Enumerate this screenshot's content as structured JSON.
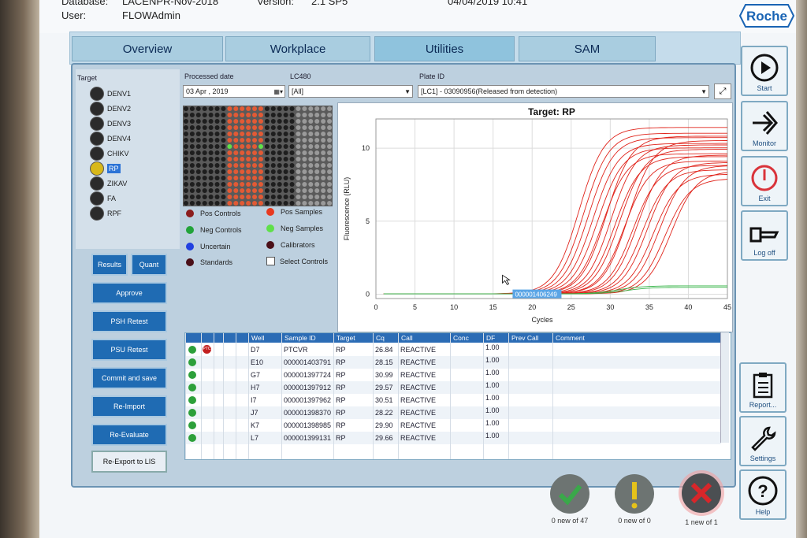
{
  "header": {
    "database_label": "Database:",
    "database_value": "LACENPR-Nov-2018",
    "user_label": "User:",
    "user_value": "FLOWAdmin",
    "version_label": "Version:",
    "version_value": "2.1 SP5",
    "datetime": "04/04/2019 10:41",
    "brand": "Roche"
  },
  "nav": {
    "tabs": [
      "Overview",
      "Workplace",
      "Utilities",
      "SAM"
    ]
  },
  "right_sidebar": {
    "start": "Start",
    "monitor": "Monitor",
    "exit": "Exit",
    "logoff": "Log off",
    "report": "Report...",
    "settings": "Settings",
    "help": "Help"
  },
  "target": {
    "label": "Target",
    "items": [
      "DENV1",
      "DENV2",
      "DENV3",
      "DENV4",
      "CHIKV",
      "RP",
      "ZIKAV",
      "FA",
      "RPF"
    ],
    "selected_index": 5
  },
  "filters": {
    "processed_date_label": "Processed date",
    "processed_date_value": "03 Apr , 2019",
    "lc480_label": "LC480",
    "lc480_value": "[All]",
    "plate_id_label": "Plate ID",
    "plate_id_value": "[LC1] - 03090956(Released from detection)"
  },
  "legend": {
    "pos_controls": "Pos Controls",
    "pos_samples": "Pos Samples",
    "neg_controls": "Neg Controls",
    "neg_samples": "Neg Samples",
    "uncertain": "Uncertain",
    "calibrators": "Calibrators",
    "standards": "Standards",
    "select_controls": "Select Controls"
  },
  "buttons": {
    "results": "Results",
    "quant": "Quant",
    "approve": "Approve",
    "psh_retest": "PSH Retest",
    "psu_retest": "PSU Retest",
    "commit_save": "Commit and save",
    "reimport": "Re-Import",
    "reevaluate": "Re-Evaluate",
    "reexport": "Re-Export to LIS"
  },
  "chart_data": {
    "type": "line",
    "title": "Target: RP",
    "xlabel": "Cycles",
    "ylabel": "Fluorescence (RLU)",
    "xlim": [
      0,
      45
    ],
    "ylim": [
      -0.3,
      12
    ],
    "xticks": [
      0,
      5,
      10,
      15,
      20,
      25,
      30,
      35,
      40,
      45
    ],
    "yticks": [
      0,
      5,
      10
    ],
    "grid": true,
    "tooltip": "000001406249",
    "series": [
      {
        "color": "#e0241b",
        "curves": [
          {
            "ct": 26.0,
            "max": 11.4
          },
          {
            "ct": 26.6,
            "max": 11.0
          },
          {
            "ct": 27.2,
            "max": 10.7
          },
          {
            "ct": 27.8,
            "max": 10.3
          },
          {
            "ct": 28.4,
            "max": 10.0
          },
          {
            "ct": 29.0,
            "max": 9.6
          },
          {
            "ct": 29.5,
            "max": 10.8
          },
          {
            "ct": 30.1,
            "max": 10.2
          },
          {
            "ct": 30.6,
            "max": 9.4
          },
          {
            "ct": 31.2,
            "max": 9.9
          },
          {
            "ct": 31.8,
            "max": 9.1
          },
          {
            "ct": 32.3,
            "max": 10.5
          },
          {
            "ct": 32.9,
            "max": 8.8
          },
          {
            "ct": 33.5,
            "max": 9.5
          },
          {
            "ct": 34.1,
            "max": 8.5
          },
          {
            "ct": 34.8,
            "max": 9.0
          },
          {
            "ct": 35.5,
            "max": 8.2
          },
          {
            "ct": 36.3,
            "max": 8.8
          },
          {
            "ct": 37.0,
            "max": 7.9
          },
          {
            "ct": 37.8,
            "max": 8.4
          }
        ]
      },
      {
        "color": "#38b54a",
        "curves": [
          {
            "ct": 31.0,
            "max": 0.55
          },
          {
            "ct": 32.0,
            "max": 0.45
          }
        ]
      }
    ]
  },
  "table": {
    "columns": [
      "Well",
      "Sample ID",
      "Target",
      "Cq",
      "Call",
      "Conc",
      "DF",
      "Prev Call",
      "Comment"
    ],
    "rows": [
      {
        "well": "D7",
        "sample": "PTCVR",
        "target": "RP",
        "cq": "26.84",
        "call": "REACTIVE",
        "df": "1.00",
        "badge": "PTC"
      },
      {
        "well": "E10",
        "sample": "000001403791",
        "target": "RP",
        "cq": "28.15",
        "call": "REACTIVE",
        "df": "1.00"
      },
      {
        "well": "G7",
        "sample": "000001397724",
        "target": "RP",
        "cq": "30.99",
        "call": "REACTIVE",
        "df": "1.00"
      },
      {
        "well": "H7",
        "sample": "000001397912",
        "target": "RP",
        "cq": "29.57",
        "call": "REACTIVE",
        "df": "1.00"
      },
      {
        "well": "I7",
        "sample": "000001397962",
        "target": "RP",
        "cq": "30.51",
        "call": "REACTIVE",
        "df": "1.00"
      },
      {
        "well": "J7",
        "sample": "000001398370",
        "target": "RP",
        "cq": "28.22",
        "call": "REACTIVE",
        "df": "1.00"
      },
      {
        "well": "K7",
        "sample": "000001398985",
        "target": "RP",
        "cq": "29.90",
        "call": "REACTIVE",
        "df": "1.00"
      },
      {
        "well": "L7",
        "sample": "000001399131",
        "target": "RP",
        "cq": "29.66",
        "call": "REACTIVE",
        "df": "1.00"
      }
    ]
  },
  "status": {
    "green": "0 new of 47",
    "yellow": "0 new of 0",
    "red": "1 new of 1",
    "colors": {
      "green": "#3aa84a",
      "yellow": "#e6c21a",
      "red": "#d8262a"
    }
  }
}
